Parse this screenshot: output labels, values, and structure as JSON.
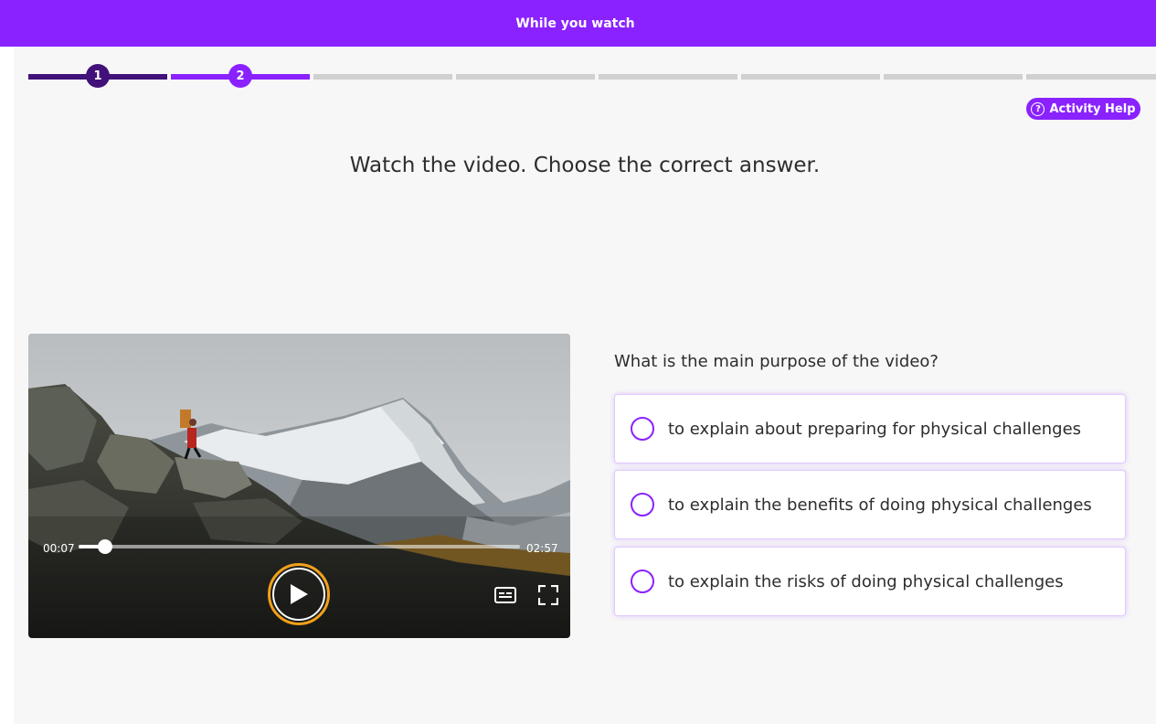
{
  "header": {
    "title": "While you watch"
  },
  "progress": {
    "steps": [
      {
        "label": "1",
        "state": "done"
      },
      {
        "label": "2",
        "state": "current"
      },
      {
        "label": "",
        "state": "todo"
      },
      {
        "label": "",
        "state": "todo"
      },
      {
        "label": "",
        "state": "todo"
      },
      {
        "label": "",
        "state": "todo"
      },
      {
        "label": "",
        "state": "todo"
      },
      {
        "label": "",
        "state": "todo"
      }
    ]
  },
  "help": {
    "label": "Activity Help",
    "icon": "question-circle-icon"
  },
  "instruction": "Watch the video. Choose the correct answer.",
  "video": {
    "current_time": "00:07",
    "duration": "02:57",
    "progress_fraction": 0.06,
    "play_icon": "play-icon",
    "captions_icon": "captions-icon",
    "fullscreen_icon": "fullscreen-icon"
  },
  "question": {
    "text": "What is the main purpose of the video?",
    "options": [
      {
        "label": "to explain about preparing for physical challenges"
      },
      {
        "label": "to explain the benefits of doing physical challenges"
      },
      {
        "label": "to explain the risks of doing physical challenges"
      }
    ]
  },
  "colors": {
    "brand": "#8a22ff",
    "done": "#42117a",
    "accent": "#f2a11a"
  }
}
